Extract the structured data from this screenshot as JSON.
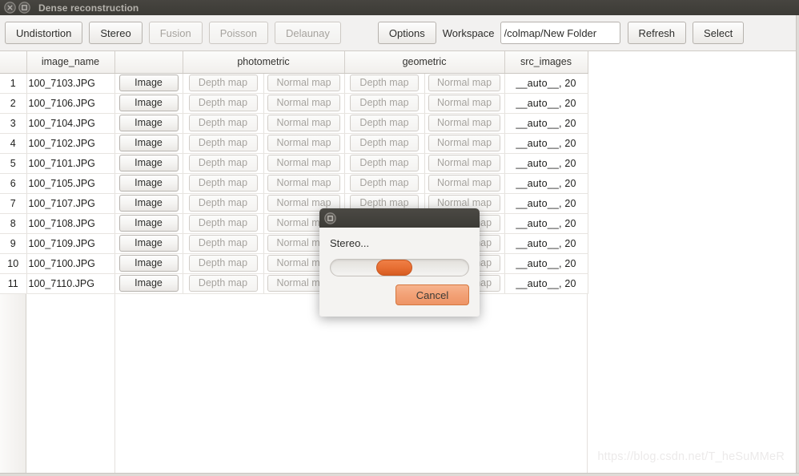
{
  "window": {
    "title": "Dense reconstruction",
    "close_icon": "close-icon",
    "maximize_icon": "maximize-icon"
  },
  "toolbar": {
    "undistortion_label": "Undistortion",
    "stereo_label": "Stereo",
    "fusion_label": "Fusion",
    "poisson_label": "Poisson",
    "delaunay_label": "Delaunay",
    "options_label": "Options",
    "workspace_label": "Workspace",
    "workspace_value": "/colmap/New Folder",
    "workspace_placeholder": "",
    "refresh_label": "Refresh",
    "select_label": "Select"
  },
  "table": {
    "headers": {
      "corner": "",
      "image_name": "image_name",
      "image_col": "",
      "photometric": "photometric",
      "geometric": "geometric",
      "src_images": "src_images"
    },
    "cell_labels": {
      "image": "Image",
      "depth_map": "Depth map",
      "normal_map": "Normal map"
    },
    "rows": [
      {
        "index": "1",
        "image_name": "100_7103.JPG",
        "src_images": "__auto__, 20"
      },
      {
        "index": "2",
        "image_name": "100_7106.JPG",
        "src_images": "__auto__, 20"
      },
      {
        "index": "3",
        "image_name": "100_7104.JPG",
        "src_images": "__auto__, 20"
      },
      {
        "index": "4",
        "image_name": "100_7102.JPG",
        "src_images": "__auto__, 20"
      },
      {
        "index": "5",
        "image_name": "100_7101.JPG",
        "src_images": "__auto__, 20"
      },
      {
        "index": "6",
        "image_name": "100_7105.JPG",
        "src_images": "__auto__, 20"
      },
      {
        "index": "7",
        "image_name": "100_7107.JPG",
        "src_images": "__auto__, 20"
      },
      {
        "index": "8",
        "image_name": "100_7108.JPG",
        "src_images": "__auto__, 20"
      },
      {
        "index": "9",
        "image_name": "100_7109.JPG",
        "src_images": "__auto__, 20"
      },
      {
        "index": "10",
        "image_name": "100_7100.JPG",
        "src_images": "__auto__, 20"
      },
      {
        "index": "11",
        "image_name": "100_7110.JPG",
        "src_images": "__auto__, 20"
      }
    ]
  },
  "dialog": {
    "maximize_icon": "maximize-icon",
    "status_label": "Stereo...",
    "progress_percent": 45,
    "cancel_label": "Cancel"
  },
  "watermark": {
    "text": "https://blog.csdn.net/T_heSuMMeR"
  },
  "colors": {
    "accent_orange": "#e76f33",
    "cancel_orange": "#f2a075",
    "titlebar": "#3c3b36",
    "window_bg": "#f2f1f0"
  }
}
